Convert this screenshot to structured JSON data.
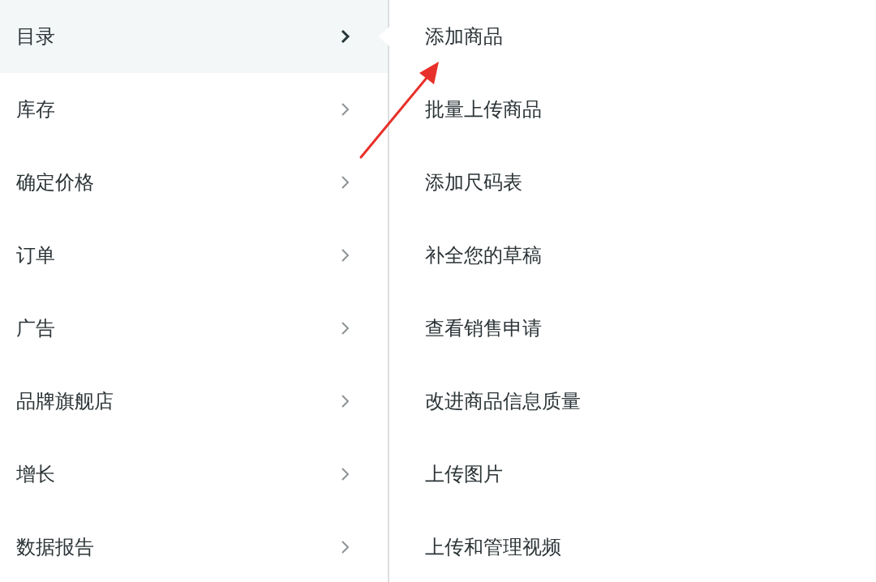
{
  "menu": {
    "items": [
      {
        "label": "目录",
        "selected": true
      },
      {
        "label": "库存",
        "selected": false
      },
      {
        "label": "确定价格",
        "selected": false
      },
      {
        "label": "订单",
        "selected": false
      },
      {
        "label": "广告",
        "selected": false
      },
      {
        "label": "品牌旗舰店",
        "selected": false
      },
      {
        "label": "增长",
        "selected": false
      },
      {
        "label": "数据报告",
        "selected": false
      }
    ]
  },
  "submenu": {
    "items": [
      {
        "label": "添加商品"
      },
      {
        "label": "批量上传商品"
      },
      {
        "label": "添加尺码表"
      },
      {
        "label": "补全您的草稿"
      },
      {
        "label": "查看销售申请"
      },
      {
        "label": "改进商品信息质量"
      },
      {
        "label": "上传图片"
      },
      {
        "label": "上传和管理视频"
      }
    ]
  }
}
